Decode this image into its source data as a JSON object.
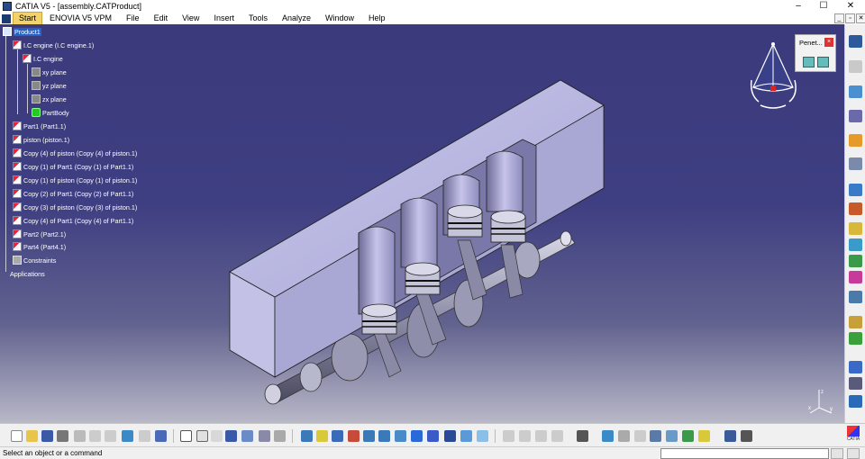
{
  "window": {
    "title": "CATIA V5 - [assembly.CATProduct]",
    "controls": [
      "–",
      "☐",
      "✕"
    ]
  },
  "menu": {
    "items": [
      "Start",
      "ENOVIA V5 VPM",
      "File",
      "Edit",
      "View",
      "Insert",
      "Tools",
      "Analyze",
      "Window",
      "Help"
    ],
    "doc_controls": [
      "_",
      "▫",
      "✕"
    ]
  },
  "tree": {
    "nodes": [
      {
        "label": "Product1",
        "icon": "product-icon",
        "selected": true
      },
      {
        "label": "I.C engine (I.C engine.1)",
        "icon": "part-icon"
      },
      {
        "label": "I.C engine",
        "icon": "part-icon"
      },
      {
        "label": "xy plane",
        "icon": "plane-icon"
      },
      {
        "label": "yz plane",
        "icon": "plane-icon"
      },
      {
        "label": "zx plane",
        "icon": "plane-icon"
      },
      {
        "label": "PartBody",
        "icon": "partbody-icon"
      },
      {
        "label": "Part1 (Part1.1)",
        "icon": "part-icon"
      },
      {
        "label": "piston (piston.1)",
        "icon": "part-icon"
      },
      {
        "label": "Copy (4) of piston (Copy (4) of piston.1)",
        "icon": "part-icon"
      },
      {
        "label": "Copy (1) of Part1 (Copy (1) of Part1.1)",
        "icon": "part-icon"
      },
      {
        "label": "Copy (1) of piston (Copy (1) of piston.1)",
        "icon": "part-icon"
      },
      {
        "label": "Copy (2) of Part1 (Copy (2) of Part1.1)",
        "icon": "part-icon"
      },
      {
        "label": "Copy (3) of piston (Copy (3) of piston.1)",
        "icon": "part-icon"
      },
      {
        "label": "Copy (4) of Part1 (Copy (4) of Part1.1)",
        "icon": "part-icon"
      },
      {
        "label": "Part2 (Part2.1)",
        "icon": "part-icon"
      },
      {
        "label": "Part4 (Part4.1)",
        "icon": "part-icon"
      },
      {
        "label": "Constraints",
        "icon": "constraints-icon"
      },
      {
        "label": "Applications",
        "icon": "applications-icon"
      }
    ]
  },
  "penetration_panel": {
    "title": "Penet...",
    "close": "×"
  },
  "status": {
    "message": "Select an object or a command",
    "command_value": ""
  },
  "logo": {
    "text": "CATIA"
  },
  "colors": {
    "viewport_top": "#3a3a7c",
    "viewport_bottom": "#b8b8c8",
    "model": "#b8b6de",
    "selection": "#2462c8"
  }
}
